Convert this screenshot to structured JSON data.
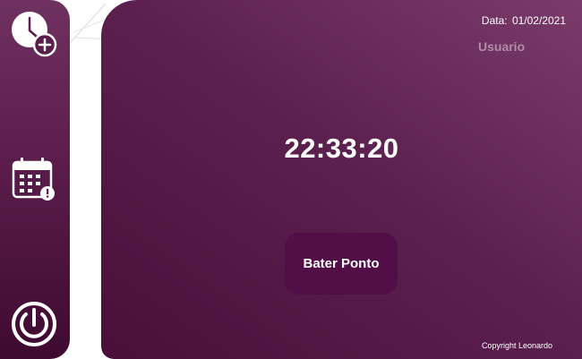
{
  "sidebar": {
    "items": [
      {
        "icon": "add-clock-icon"
      },
      {
        "icon": "calendar-alert-icon"
      },
      {
        "icon": "power-icon"
      }
    ]
  },
  "header": {
    "date_label": "Data:",
    "date_value": "01/02/2021",
    "user": "Usuario"
  },
  "main": {
    "clock": "22:33:20",
    "punch_button": "Bater Ponto",
    "copyright": "Copyright Leonardo"
  },
  "colors": {
    "sidebar": "#5b1d4c",
    "panel": "#5d2150",
    "button": "#520e47",
    "user_text": "#b28ba6"
  }
}
